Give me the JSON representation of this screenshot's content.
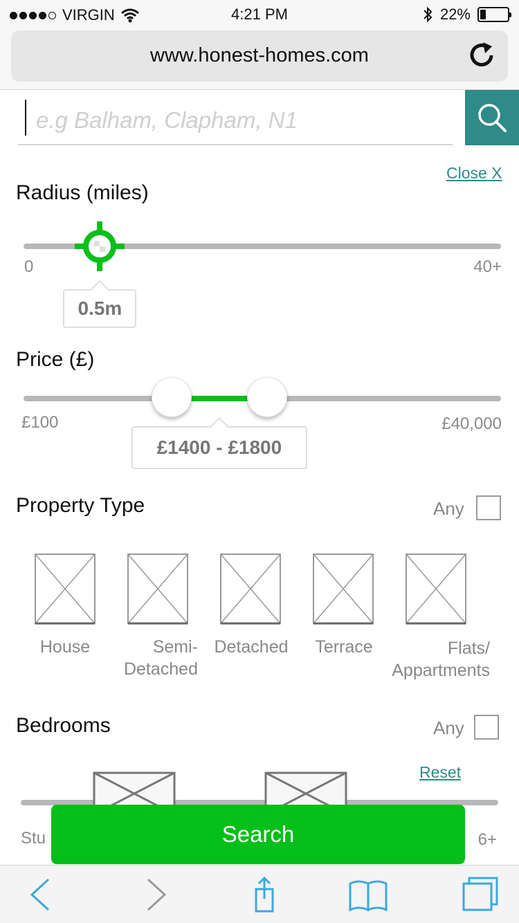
{
  "status_bar": {
    "carrier": "VIRGIN",
    "time": "4:21 PM",
    "battery_percent": "22%",
    "battery_level": 0.22,
    "signal_bars_filled": 4,
    "signal_bars_total": 5,
    "icons": [
      "wifi-icon",
      "bluetooth-icon",
      "battery-icon"
    ]
  },
  "browser": {
    "url": "www.honest-homes.com",
    "reload_icon": "reload-icon"
  },
  "search": {
    "placeholder": "e.g Balham, Clapham, N1",
    "value": "",
    "button_icon": "search-icon",
    "close_label": "Close X"
  },
  "radius": {
    "title": "Radius (miles)",
    "min_label": "0",
    "max_label": "40+",
    "value_label": "0.5m",
    "value_fraction": 0.16
  },
  "price": {
    "title": "Price (£)",
    "min_label": "£100",
    "max_label": "£40,000",
    "range_label": "£1400 - £1800",
    "low_fraction": 0.31,
    "high_fraction": 0.51
  },
  "property_type": {
    "title": "Property Type",
    "any_label": "Any",
    "any_checked": false,
    "types": [
      {
        "label": "House"
      },
      {
        "label": "Semi-\nDetached"
      },
      {
        "label": "Detached"
      },
      {
        "label": "Terrace"
      },
      {
        "label": "Flats/\nAppartments"
      }
    ]
  },
  "bedrooms": {
    "title": "Bedrooms",
    "any_label": "Any",
    "any_checked": false,
    "reset_label": "Reset",
    "min_label": "Stu",
    "max_label": "6+"
  },
  "cta": {
    "search_label": "Search",
    "color": "#04bf19"
  },
  "colors": {
    "accent": "#2e8b88",
    "slider_green": "#0cbe1c",
    "toolbar_blue": "#3aa9dd"
  },
  "toolbar": {
    "icons": [
      "back-icon",
      "forward-icon",
      "share-icon",
      "bookmarks-icon",
      "tabs-icon"
    ]
  }
}
